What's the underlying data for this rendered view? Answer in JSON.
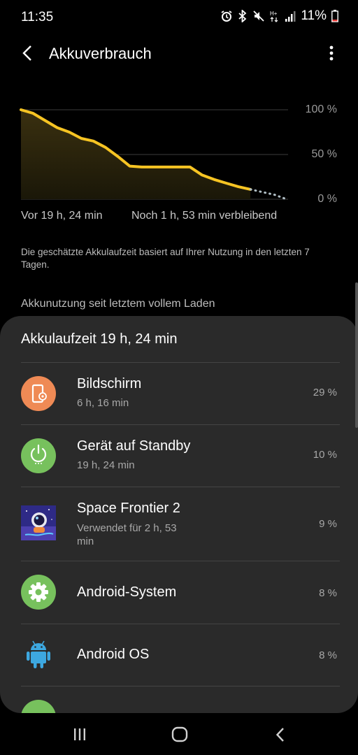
{
  "status_bar": {
    "time": "11:35",
    "battery_percent": "11%",
    "icons": [
      "alarm-icon",
      "bluetooth-icon",
      "mute-icon",
      "hplus-icon",
      "signal-icon",
      "battery-icon"
    ]
  },
  "header": {
    "title": "Akkuverbrauch",
    "back_icon": "back-arrow-icon",
    "menu_icon": "more-vert-icon"
  },
  "chart": {
    "axis_labels": [
      "100 %",
      "50 %",
      "0 %"
    ],
    "start_label": "Vor 19 h, 24 min",
    "end_label": "Noch 1 h, 53 min verbleibend",
    "line_color": "#f6c423"
  },
  "chart_data": {
    "type": "area",
    "yunit": "%",
    "ylim": [
      0,
      100
    ],
    "series": [
      {
        "values": [
          100,
          96,
          88,
          80,
          75,
          68,
          65,
          58,
          48,
          37,
          36,
          36,
          36,
          36,
          36,
          27,
          22,
          18,
          14,
          11
        ]
      },
      {
        "values": [
          11,
          8,
          5,
          0
        ]
      }
    ],
    "y_ticks": [
      "100 %",
      "50 %",
      "0 %"
    ],
    "grid": true
  },
  "note": "Die geschätzte Akkulaufzeit basiert auf Ihrer Nutzung in den letzten 7 Tagen.",
  "section_header": "Akkunutzung seit letztem vollem Laden",
  "panel": {
    "title": "Akkulaufzeit 19 h, 24 min",
    "items": [
      {
        "name": "Bildschirm",
        "sub": "6 h, 16 min",
        "percent": "29 %",
        "icon": "screen-icon",
        "color": "#ef8a55"
      },
      {
        "name": "Gerät auf Standby",
        "sub": "19 h, 24 min",
        "percent": "10 %",
        "icon": "power-standby-icon",
        "color": "#77c15d"
      },
      {
        "name": "Space Frontier 2",
        "sub": "Verwendet für 2 h, 53 min",
        "percent": "9 %",
        "icon": "space-frontier-app-icon",
        "color": "#3a2f86"
      },
      {
        "name": "Android-System",
        "sub": "",
        "percent": "8 %",
        "icon": "gear-icon",
        "color": "#77c15d"
      },
      {
        "name": "Android OS",
        "sub": "",
        "percent": "8 %",
        "icon": "android-icon",
        "color": "#3da8e0"
      }
    ]
  },
  "nav": {
    "icons": [
      "recents-icon",
      "home-icon",
      "back-icon"
    ]
  }
}
